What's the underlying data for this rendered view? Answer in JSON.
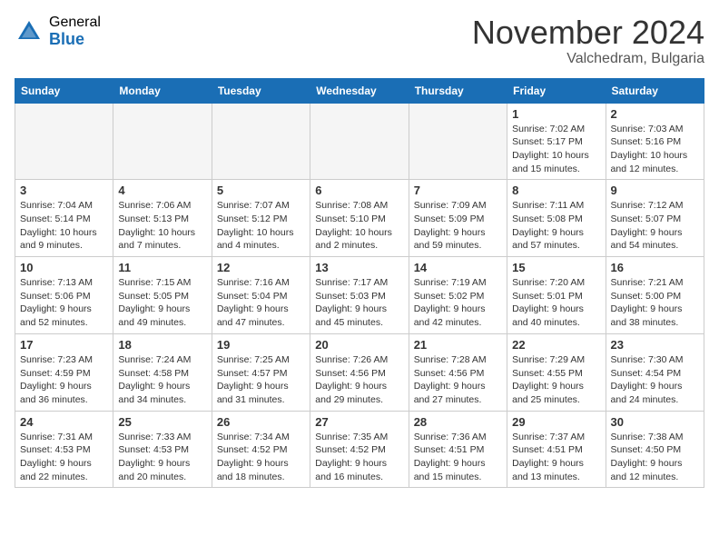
{
  "header": {
    "logo_general": "General",
    "logo_blue": "Blue",
    "month_title": "November 2024",
    "location": "Valchedram, Bulgaria"
  },
  "calendar": {
    "headers": [
      "Sunday",
      "Monday",
      "Tuesday",
      "Wednesday",
      "Thursday",
      "Friday",
      "Saturday"
    ],
    "weeks": [
      [
        {
          "day": "",
          "info": ""
        },
        {
          "day": "",
          "info": ""
        },
        {
          "day": "",
          "info": ""
        },
        {
          "day": "",
          "info": ""
        },
        {
          "day": "",
          "info": ""
        },
        {
          "day": "1",
          "info": "Sunrise: 7:02 AM\nSunset: 5:17 PM\nDaylight: 10 hours and 15 minutes."
        },
        {
          "day": "2",
          "info": "Sunrise: 7:03 AM\nSunset: 5:16 PM\nDaylight: 10 hours and 12 minutes."
        }
      ],
      [
        {
          "day": "3",
          "info": "Sunrise: 7:04 AM\nSunset: 5:14 PM\nDaylight: 10 hours and 9 minutes."
        },
        {
          "day": "4",
          "info": "Sunrise: 7:06 AM\nSunset: 5:13 PM\nDaylight: 10 hours and 7 minutes."
        },
        {
          "day": "5",
          "info": "Sunrise: 7:07 AM\nSunset: 5:12 PM\nDaylight: 10 hours and 4 minutes."
        },
        {
          "day": "6",
          "info": "Sunrise: 7:08 AM\nSunset: 5:10 PM\nDaylight: 10 hours and 2 minutes."
        },
        {
          "day": "7",
          "info": "Sunrise: 7:09 AM\nSunset: 5:09 PM\nDaylight: 9 hours and 59 minutes."
        },
        {
          "day": "8",
          "info": "Sunrise: 7:11 AM\nSunset: 5:08 PM\nDaylight: 9 hours and 57 minutes."
        },
        {
          "day": "9",
          "info": "Sunrise: 7:12 AM\nSunset: 5:07 PM\nDaylight: 9 hours and 54 minutes."
        }
      ],
      [
        {
          "day": "10",
          "info": "Sunrise: 7:13 AM\nSunset: 5:06 PM\nDaylight: 9 hours and 52 minutes."
        },
        {
          "day": "11",
          "info": "Sunrise: 7:15 AM\nSunset: 5:05 PM\nDaylight: 9 hours and 49 minutes."
        },
        {
          "day": "12",
          "info": "Sunrise: 7:16 AM\nSunset: 5:04 PM\nDaylight: 9 hours and 47 minutes."
        },
        {
          "day": "13",
          "info": "Sunrise: 7:17 AM\nSunset: 5:03 PM\nDaylight: 9 hours and 45 minutes."
        },
        {
          "day": "14",
          "info": "Sunrise: 7:19 AM\nSunset: 5:02 PM\nDaylight: 9 hours and 42 minutes."
        },
        {
          "day": "15",
          "info": "Sunrise: 7:20 AM\nSunset: 5:01 PM\nDaylight: 9 hours and 40 minutes."
        },
        {
          "day": "16",
          "info": "Sunrise: 7:21 AM\nSunset: 5:00 PM\nDaylight: 9 hours and 38 minutes."
        }
      ],
      [
        {
          "day": "17",
          "info": "Sunrise: 7:23 AM\nSunset: 4:59 PM\nDaylight: 9 hours and 36 minutes."
        },
        {
          "day": "18",
          "info": "Sunrise: 7:24 AM\nSunset: 4:58 PM\nDaylight: 9 hours and 34 minutes."
        },
        {
          "day": "19",
          "info": "Sunrise: 7:25 AM\nSunset: 4:57 PM\nDaylight: 9 hours and 31 minutes."
        },
        {
          "day": "20",
          "info": "Sunrise: 7:26 AM\nSunset: 4:56 PM\nDaylight: 9 hours and 29 minutes."
        },
        {
          "day": "21",
          "info": "Sunrise: 7:28 AM\nSunset: 4:56 PM\nDaylight: 9 hours and 27 minutes."
        },
        {
          "day": "22",
          "info": "Sunrise: 7:29 AM\nSunset: 4:55 PM\nDaylight: 9 hours and 25 minutes."
        },
        {
          "day": "23",
          "info": "Sunrise: 7:30 AM\nSunset: 4:54 PM\nDaylight: 9 hours and 24 minutes."
        }
      ],
      [
        {
          "day": "24",
          "info": "Sunrise: 7:31 AM\nSunset: 4:53 PM\nDaylight: 9 hours and 22 minutes."
        },
        {
          "day": "25",
          "info": "Sunrise: 7:33 AM\nSunset: 4:53 PM\nDaylight: 9 hours and 20 minutes."
        },
        {
          "day": "26",
          "info": "Sunrise: 7:34 AM\nSunset: 4:52 PM\nDaylight: 9 hours and 18 minutes."
        },
        {
          "day": "27",
          "info": "Sunrise: 7:35 AM\nSunset: 4:52 PM\nDaylight: 9 hours and 16 minutes."
        },
        {
          "day": "28",
          "info": "Sunrise: 7:36 AM\nSunset: 4:51 PM\nDaylight: 9 hours and 15 minutes."
        },
        {
          "day": "29",
          "info": "Sunrise: 7:37 AM\nSunset: 4:51 PM\nDaylight: 9 hours and 13 minutes."
        },
        {
          "day": "30",
          "info": "Sunrise: 7:38 AM\nSunset: 4:50 PM\nDaylight: 9 hours and 12 minutes."
        }
      ]
    ]
  }
}
